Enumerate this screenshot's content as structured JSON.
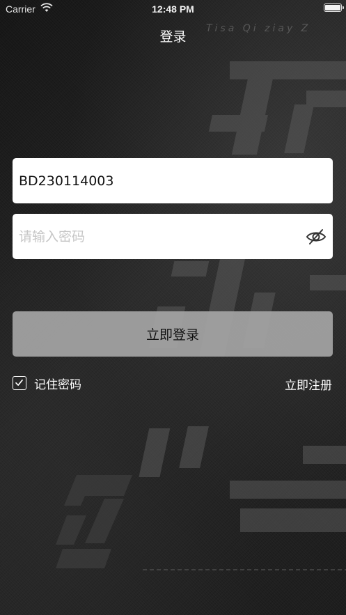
{
  "status_bar": {
    "carrier": "Carrier",
    "time": "12:48 PM"
  },
  "header": {
    "title": "登录"
  },
  "form": {
    "account_value": "BD230114003",
    "password_placeholder": "请输入密码",
    "password_toggle_icon": "eye-slash-icon",
    "login_label": "立即登录",
    "remember_label": "记住密码",
    "remember_checked": true,
    "register_label": "立即注册"
  },
  "colors": {
    "background": "#1c1c1c",
    "input_background": "#ffffff",
    "button_background": "#a5a5a5",
    "text_primary": "#ffffff"
  }
}
